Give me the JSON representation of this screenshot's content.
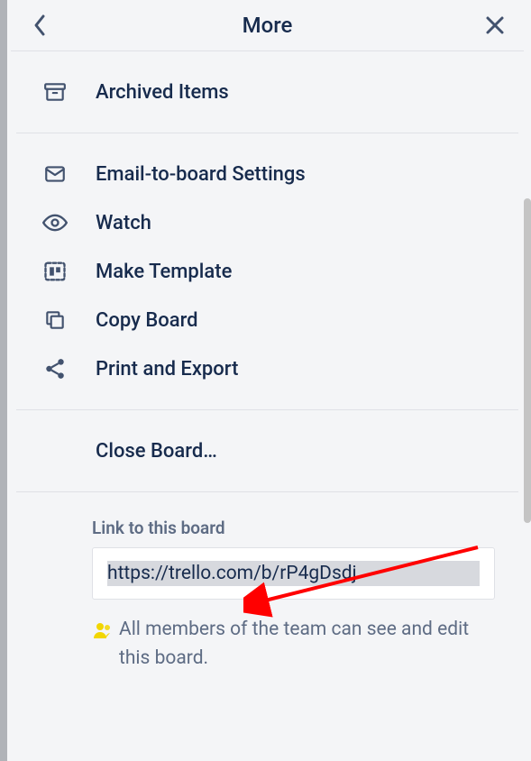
{
  "header": {
    "title": "More"
  },
  "menu": {
    "archived_items": "Archived Items",
    "email_settings": "Email-to-board Settings",
    "watch": "Watch",
    "make_template": "Make Template",
    "copy_board": "Copy Board",
    "print_export": "Print and Export",
    "close_board": "Close Board…"
  },
  "link_section": {
    "label": "Link to this board",
    "url": "https://trello.com/b/rP4gDsdj",
    "description": "All members of the team can see and edit this board."
  }
}
